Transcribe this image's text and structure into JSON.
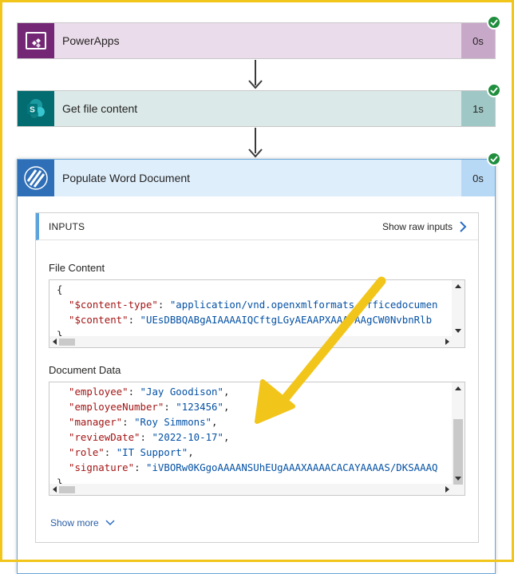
{
  "flow": {
    "steps": [
      {
        "title": "PowerApps",
        "duration": "0s"
      },
      {
        "title": "Get file content",
        "duration": "1s"
      },
      {
        "title": "Populate Word Document",
        "duration": "0s"
      }
    ]
  },
  "populate": {
    "inputs_label": "INPUTS",
    "show_raw_label": "Show raw inputs",
    "file_content": {
      "label": "File Content",
      "open_brace": "{",
      "close_brace": "}",
      "lines": [
        {
          "key": "\"$content-type\"",
          "value": "\"application/vnd.openxmlformats-officedocumen"
        },
        {
          "key": "\"$content\"",
          "value": "\"UEsDBBQABgAIAAAAIQCftgLGyAEAAP​XAAATAAgCW0NvbnRlb"
        }
      ]
    },
    "document_data": {
      "label": "Document Data",
      "close_brace": "}",
      "lines": [
        {
          "key": "\"employee\"",
          "value": "\"Jay Goodison\"",
          "comma": ","
        },
        {
          "key": "\"employeeNumber\"",
          "value": "\"123456\"",
          "comma": ","
        },
        {
          "key": "\"manager\"",
          "value": "\"Roy Simmons\"",
          "comma": ","
        },
        {
          "key": "\"reviewDate\"",
          "value": "\"2022-10-17\"",
          "comma": ","
        },
        {
          "key": "\"role\"",
          "value": "\"IT Support\"",
          "comma": ","
        },
        {
          "key": "\"signature\"",
          "value": "\"iVBORw0KGgoAAAANSUhEUgAAAXAAAACACAYAAAAS/DKSAAAQ",
          "comma": ""
        }
      ]
    },
    "show_more_label": "Show more"
  },
  "colors": {
    "powerapps": "#742774",
    "sharepoint": "#036c70",
    "word_template": "#2f6fb7",
    "success": "#1f8e3d",
    "annotation": "#f2c51b"
  },
  "icons": {
    "step1": "powerapps-icon",
    "step2": "sharepoint-icon",
    "step3": "word-template-icon",
    "status": "checkmark-icon",
    "raw": "chevron-right-icon",
    "more": "chevron-down-icon"
  }
}
